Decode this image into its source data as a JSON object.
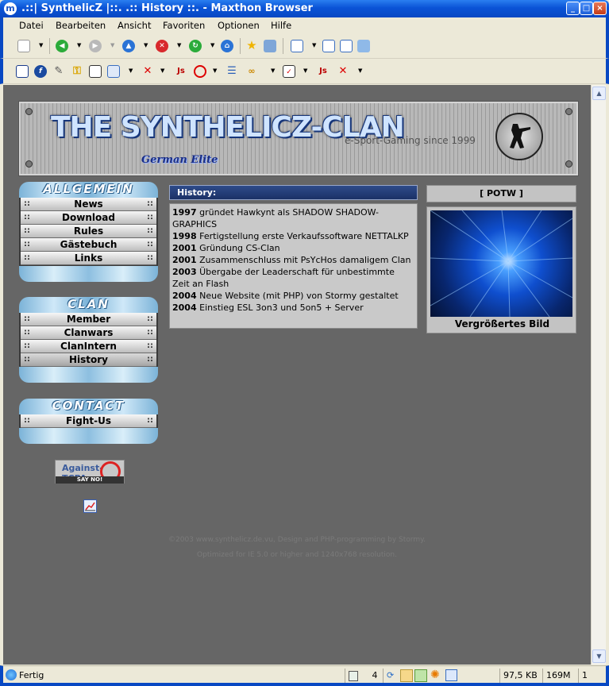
{
  "window": {
    "title": ".::| SynthelicZ |::. .:: History ::. - Maxthon Browser",
    "minimize": "_",
    "maximize": "□",
    "close": "×"
  },
  "menu": [
    "Datei",
    "Bearbeiten",
    "Ansicht",
    "Favoriten",
    "Optionen",
    "Hilfe"
  ],
  "toolbar_icons": {
    "row1": [
      "new-page-icon",
      "back-icon",
      "forward-icon",
      "up-icon",
      "stop-icon",
      "refresh-icon",
      "home-icon",
      "favorites-star-icon",
      "notes-icon",
      "view-icon",
      "fullscreen-icon",
      "split-icon",
      "plugins-icon"
    ],
    "row2": [
      "page-icon",
      "flash-icon",
      "link-icon",
      "key-icon",
      "document-icon",
      "table-icon",
      "no-images-icon",
      "js-icon",
      "block-icon",
      "list-icon",
      "filter-icon",
      "checkbox-icon",
      "js-toggle-icon",
      "cancel-icon"
    ]
  },
  "header": {
    "title": "THE SYNTHELICZ-CLAN",
    "subtitle": "German Elite",
    "slogan": "e-Sport-Gaming since 1999"
  },
  "nav": {
    "allgemein": {
      "title": "ALLGEMEIN",
      "items": [
        "News",
        "Download",
        "Rules",
        "Gästebuch",
        "Links"
      ]
    },
    "clan": {
      "title": "CLAN",
      "items": [
        "Member",
        "Clanwars",
        "ClanIntern",
        "History"
      ]
    },
    "contact": {
      "title": "CONTACT",
      "items": [
        "Fight-Us"
      ]
    }
  },
  "history": {
    "heading": "History:",
    "entries": [
      {
        "year": "1997",
        "text": "gründet Hawkynt als SHADOW SHADOW-GRAPHICS"
      },
      {
        "year": "1998",
        "text": "Fertigstellung erste Verkaufssoftware NETTALKP"
      },
      {
        "year": "2001",
        "text": "Gründung CS-Clan"
      },
      {
        "year": "2001",
        "text": "Zusammenschluss mit PsYcHos damaligem Clan"
      },
      {
        "year": "2003",
        "text": "Übergabe der Leaderschaft für unbestimmte Zeit an Flash"
      },
      {
        "year": "2004",
        "text": "Neue Website (mit PHP) von Stormy gestaltet"
      },
      {
        "year": "2004",
        "text": "Einstieg ESL 3on3 und 5on5 + Server"
      }
    ]
  },
  "potw": {
    "heading": "[ POTW ]",
    "caption": "Vergrößertes Bild"
  },
  "badge": {
    "text": "Against-TCPA",
    "subtext": "SAY NO!"
  },
  "footer": {
    "line1": "©2003 www.synthelicz.de.vu, Design and PHP-programming by Stormy.",
    "line2": "Optimized for IE 5.0 or higher and 1240x768 resolution."
  },
  "status": {
    "text": "Fertig",
    "count": "4",
    "size": "97,5 KB",
    "memory": "169M",
    "tabs": "1"
  }
}
